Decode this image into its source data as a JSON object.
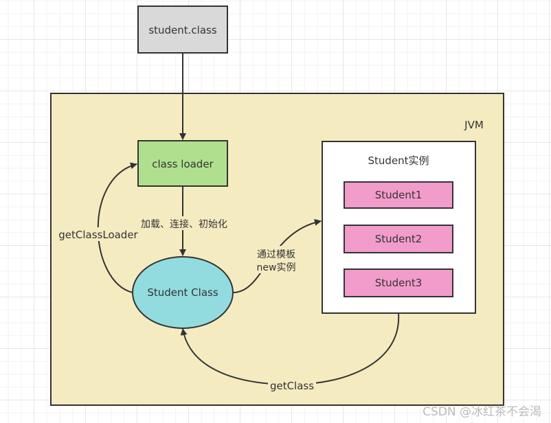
{
  "nodes": {
    "student_class_file": "student.class",
    "jvm": "JVM",
    "class_loader": "class loader",
    "student_class": "Student Class",
    "instances_box": "Student实例",
    "student1": "Student1",
    "student2": "Student2",
    "student3": "Student3"
  },
  "edges": {
    "load_link_init": "加载、连接、初始化",
    "get_class_loader": "getClassLoader",
    "new_instance_line1": "通过模板",
    "new_instance_line2": "new实例",
    "get_class": "getClass"
  },
  "colors": {
    "file_box": "#d9d9d9",
    "jvm_bg": "#f5ebc1",
    "class_loader": "#b0e08e",
    "student_class": "#92dce0",
    "instance": "#f29ccb",
    "stroke": "#333333"
  },
  "watermark": "CSDN @冰红茶不会渴"
}
